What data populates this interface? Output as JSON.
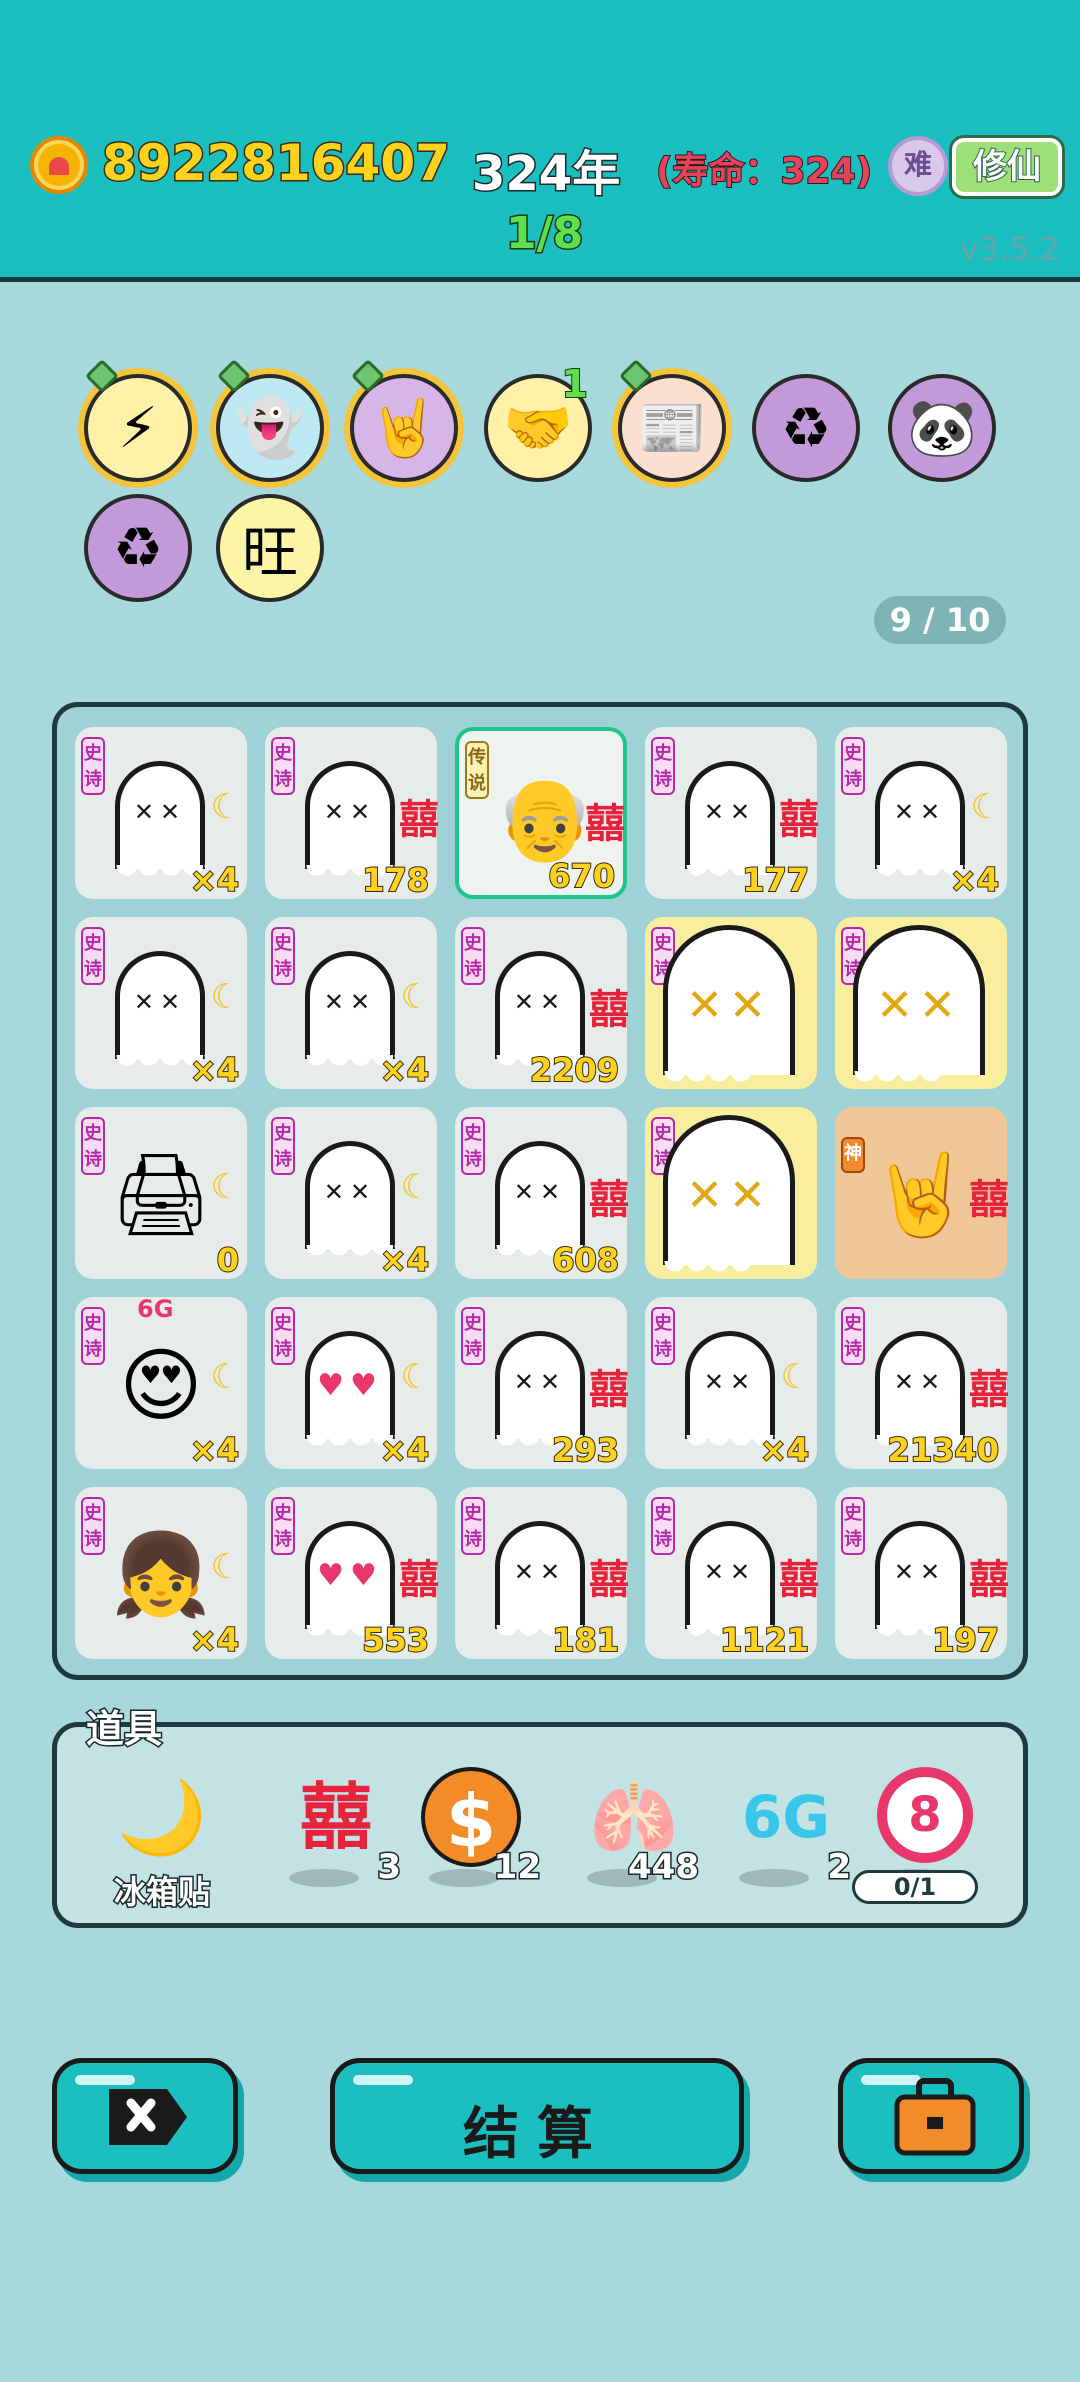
{
  "header": {
    "coins": "8922816407",
    "year": "324年",
    "lifespan": "(寿命：324)",
    "difficulty_icon": "难",
    "cultivate_button": "修仙",
    "progress": "1/8",
    "version": "v3.5.2"
  },
  "skills": [
    {
      "icon": "lightning-icon",
      "glyph": "⚡",
      "pinned": true
    },
    {
      "icon": "ghost-robot-icon",
      "glyph": "👻",
      "pinned": true
    },
    {
      "icon": "rock-hand-icon",
      "glyph": "🤘",
      "pinned": true
    },
    {
      "icon": "handshake-icon",
      "glyph": "🤝",
      "count": "1"
    },
    {
      "icon": "time-magazine-icon",
      "glyph": "📰",
      "pinned": true
    },
    {
      "icon": "recycle-icon",
      "glyph": "♻"
    },
    {
      "icon": "panda-icon",
      "glyph": "🐼"
    },
    {
      "icon": "recycle-icon",
      "glyph": "♻"
    },
    {
      "icon": "wang-icon",
      "glyph": "旺"
    }
  ],
  "page_counter": "9 / 10",
  "board": {
    "rows": [
      [
        {
          "tag": "史诗",
          "kind": "ghost",
          "side": "moon",
          "value": "×4"
        },
        {
          "tag": "史诗",
          "kind": "ghost",
          "side": "xi",
          "value": "178"
        },
        {
          "tag": "传说",
          "kind": "oldman",
          "side": "xi",
          "value": "670",
          "selected": true
        },
        {
          "tag": "史诗",
          "kind": "ghost",
          "side": "xi",
          "value": "177"
        },
        {
          "tag": "史诗",
          "kind": "ghost",
          "side": "moon",
          "value": "×4"
        }
      ],
      [
        {
          "tag": "史诗",
          "kind": "ghost",
          "side": "moon",
          "value": "×4"
        },
        {
          "tag": "史诗",
          "kind": "ghost",
          "side": "moon",
          "value": "×4"
        },
        {
          "tag": "史诗",
          "kind": "ghost",
          "side": "xi",
          "value": "2209"
        },
        {
          "tag": "史诗",
          "kind": "ghost-dead",
          "side": "",
          "value": "",
          "highlight": "yellow"
        },
        {
          "tag": "史诗",
          "kind": "ghost-dead",
          "side": "",
          "value": "",
          "highlight": "yellow"
        }
      ],
      [
        {
          "tag": "史诗",
          "kind": "printer",
          "side": "moon",
          "value": "0"
        },
        {
          "tag": "史诗",
          "kind": "ghost",
          "side": "moon",
          "value": "×4"
        },
        {
          "tag": "史诗",
          "kind": "ghost",
          "side": "xi",
          "value": "608"
        },
        {
          "tag": "史诗",
          "kind": "ghost-dead",
          "side": "",
          "value": "",
          "highlight": "yellow"
        },
        {
          "tag": "神",
          "kind": "hand",
          "side": "xi",
          "value": "",
          "highlight": "orange"
        }
      ],
      [
        {
          "tag": "史诗",
          "kind": "loveface",
          "side": "moon",
          "value": "×4",
          "extra": "6G"
        },
        {
          "tag": "史诗",
          "kind": "ghost-heart",
          "side": "moon",
          "value": "×4"
        },
        {
          "tag": "史诗",
          "kind": "ghost",
          "side": "xi",
          "value": "293"
        },
        {
          "tag": "史诗",
          "kind": "ghost",
          "side": "moon",
          "value": "×4"
        },
        {
          "tag": "史诗",
          "kind": "ghost",
          "side": "xi",
          "value": "21340"
        }
      ],
      [
        {
          "tag": "史诗",
          "kind": "girl",
          "side": "moon",
          "value": "×4"
        },
        {
          "tag": "史诗",
          "kind": "ghost-heart",
          "side": "xi",
          "value": "553"
        },
        {
          "tag": "史诗",
          "kind": "ghost",
          "side": "xi",
          "value": "181"
        },
        {
          "tag": "史诗",
          "kind": "ghost",
          "side": "xi",
          "value": "1121"
        },
        {
          "tag": "史诗",
          "kind": "ghost",
          "side": "xi",
          "value": "197"
        }
      ]
    ]
  },
  "props": {
    "title": "道具",
    "items": [
      {
        "icon": "moon-sticker-icon",
        "glyph": "🌙",
        "name": "冰箱贴",
        "count": ""
      },
      {
        "icon": "double-happiness-icon",
        "glyph": "囍",
        "name": "",
        "count": "3"
      },
      {
        "icon": "dollar-coin-icon",
        "glyph": "$",
        "name": "",
        "count": "12"
      },
      {
        "icon": "liver-icon",
        "glyph": "🫁",
        "name": "",
        "count": "448"
      },
      {
        "icon": "6g-icon",
        "glyph": "6G",
        "name": "",
        "count": "2"
      },
      {
        "icon": "target-8-icon",
        "glyph": "8",
        "name": "",
        "count": ""
      }
    ],
    "quota": "0/1"
  },
  "bottom": {
    "settle_label": "结算"
  }
}
